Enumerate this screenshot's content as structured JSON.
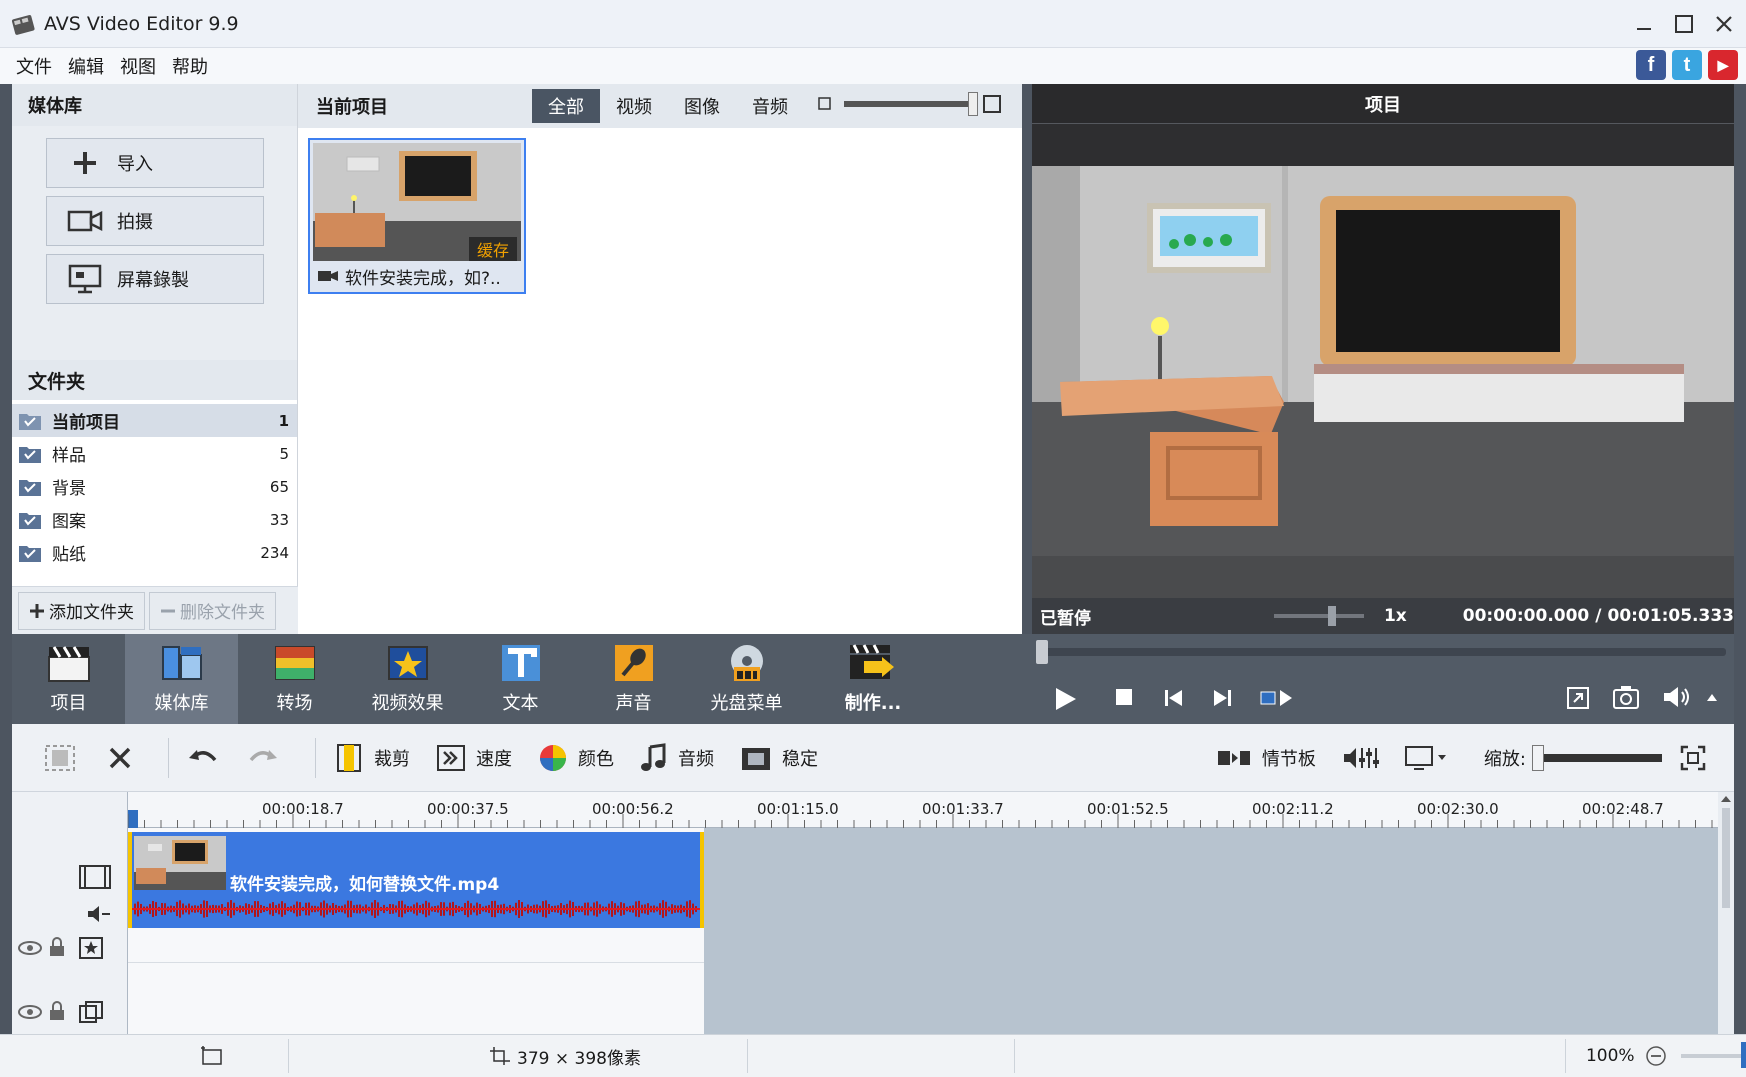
{
  "window": {
    "title": "AVS Video Editor 9.9"
  },
  "menu": {
    "items": [
      "文件",
      "编辑",
      "视图",
      "帮助"
    ]
  },
  "social": {
    "facebook": "f",
    "twitter": "t",
    "youtube": "▶"
  },
  "media_panel": {
    "header": "媒体库",
    "buttons": {
      "import": "导入",
      "capture": "拍摄",
      "screen_record": "屏幕錄製"
    },
    "folder_header": "文件夹",
    "folders": [
      {
        "name": "当前项目",
        "count": "1"
      },
      {
        "name": "样品",
        "count": "5"
      },
      {
        "name": "背景",
        "count": "65"
      },
      {
        "name": "图案",
        "count": "33"
      },
      {
        "name": "贴纸",
        "count": "234"
      }
    ],
    "add_folder": "添加文件夹",
    "delete_folder": "删除文件夹"
  },
  "project_panel": {
    "header": "当前项目",
    "tabs": [
      "全部",
      "视频",
      "图像",
      "音频"
    ],
    "item": {
      "label": "软件安装完成，如?..",
      "badge": "缓存"
    }
  },
  "preview": {
    "header": "项目",
    "status": "已暂停",
    "speed": "1x",
    "time_current": "00:00:00.000",
    "time_separator": "/",
    "time_total": "00:01:05.333"
  },
  "toolbar": {
    "tools": [
      {
        "label": "项目",
        "icon": "clapperboard-icon"
      },
      {
        "label": "媒体库",
        "icon": "media-library-icon"
      },
      {
        "label": "转场",
        "icon": "transition-icon"
      },
      {
        "label": "视频效果",
        "icon": "star-effect-icon"
      },
      {
        "label": "文本",
        "icon": "text-t-icon"
      },
      {
        "label": "声音",
        "icon": "microphone-icon"
      },
      {
        "label": "光盘菜单",
        "icon": "disc-menu-icon"
      },
      {
        "label": "制作...",
        "icon": "produce-icon"
      }
    ]
  },
  "edit_bar": {
    "crop": "裁剪",
    "speed": "速度",
    "color": "颜色",
    "audio": "音频",
    "stabilize": "稳定",
    "storyboard": "情节板",
    "zoom_label": "缩放:"
  },
  "timeline": {
    "ticks": [
      "00:00:18.7",
      "00:00:37.5",
      "00:00:56.2",
      "00:01:15.0",
      "00:01:33.7",
      "00:01:52.5",
      "00:02:11.2",
      "00:02:30.0",
      "00:02:48.7"
    ],
    "clip_title": "软件安装完成，如何替换文件.mp4"
  },
  "statusbar": {
    "dimensions": "379 × 398像素",
    "zoom": "100%"
  },
  "colors": {
    "accent": "#3b78e0",
    "toolbar_bg": "#525b66",
    "clip_border": "#f5c400"
  }
}
